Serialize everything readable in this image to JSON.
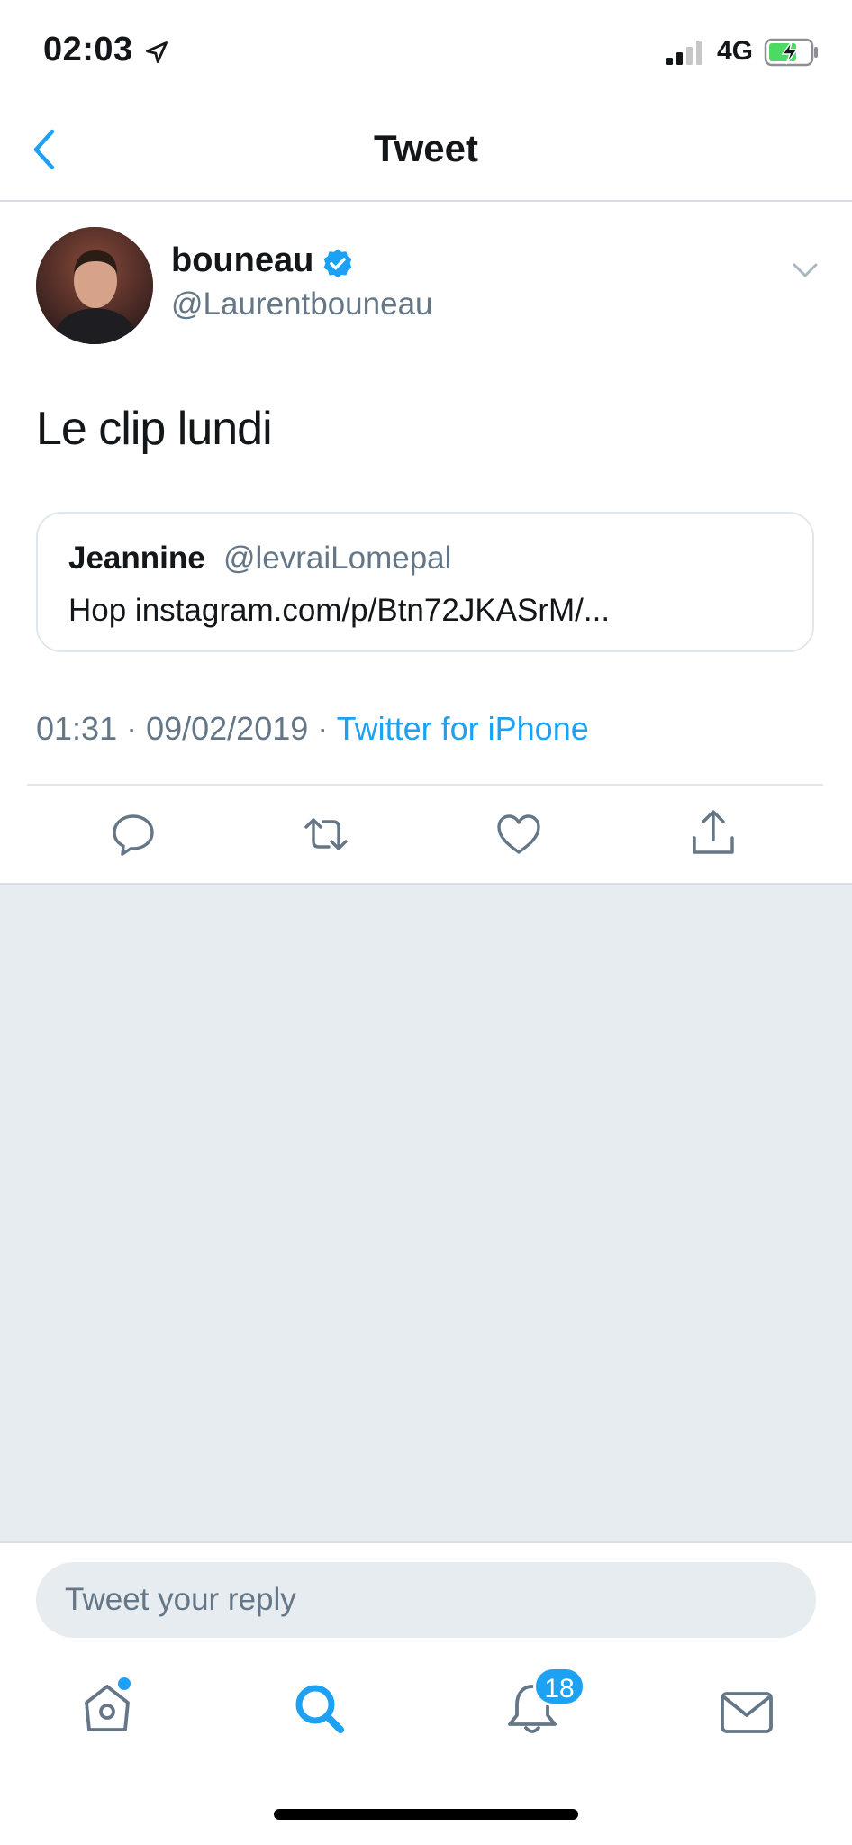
{
  "status_bar": {
    "time": "02:03",
    "network": "4G",
    "icons": {
      "location": "location-arrow-icon",
      "signal": "signal-icon",
      "battery": "battery-charging-icon"
    }
  },
  "nav": {
    "title": "Tweet",
    "back_icon": "chevron-left-icon"
  },
  "tweet": {
    "author_name": "bouneau",
    "author_handle": "@Laurentbouneau",
    "verified": true,
    "text": "Le clip lundi",
    "quoted": {
      "name": "Jeannine",
      "handle": "@levraiLomepal",
      "text": "Hop instagram.com/p/Btn72JKASrM/..."
    },
    "meta": {
      "time": "01:31",
      "separator": " · ",
      "date": "09/02/2019",
      "source": "Twitter for iPhone"
    },
    "actions": [
      "reply-icon",
      "retweet-icon",
      "like-icon",
      "share-icon"
    ]
  },
  "reply": {
    "placeholder": "Tweet your reply"
  },
  "tab_bar": {
    "items": [
      "home-icon",
      "search-icon",
      "notifications-icon",
      "messages-icon"
    ],
    "notifications_badge": "18"
  },
  "colors": {
    "accent": "#1da1f2",
    "secondary_text": "#657786",
    "background_muted": "#e6ecf0",
    "divider": "#e1e8ed"
  }
}
